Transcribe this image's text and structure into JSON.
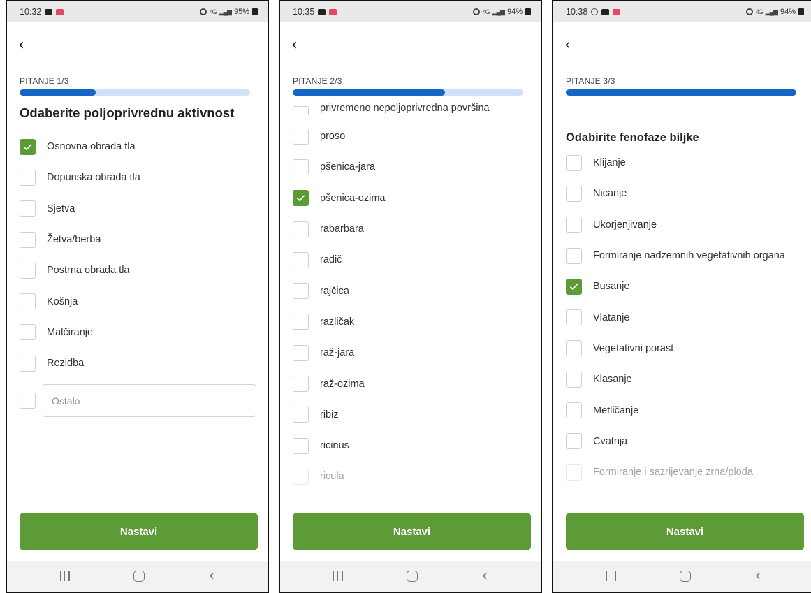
{
  "screens": [
    {
      "status": {
        "time": "10:32",
        "battery": "95%",
        "network": "4G"
      },
      "question_label": "PITANJE 1/3",
      "progress": 0.33,
      "title": "Odaberite poljoprivrednu aktivnost",
      "options": [
        {
          "label": "Osnovna obrada tla",
          "checked": true
        },
        {
          "label": "Dopunska obrada tla",
          "checked": false
        },
        {
          "label": "Sjetva",
          "checked": false
        },
        {
          "label": "Žetva/berba",
          "checked": false
        },
        {
          "label": "Postrna obrada tla",
          "checked": false
        },
        {
          "label": "Košnja",
          "checked": false
        },
        {
          "label": "Malčiranje",
          "checked": false
        },
        {
          "label": "Rezidba",
          "checked": false
        }
      ],
      "other_placeholder": "Ostalo",
      "button_label": "Nastavi"
    },
    {
      "status": {
        "time": "10:35",
        "battery": "94%",
        "network": "4G"
      },
      "question_label": "PITANJE 2/3",
      "progress": 0.66,
      "partial_top_option": "privremeno nepoljoprivredna površina",
      "options": [
        {
          "label": "proso",
          "checked": false
        },
        {
          "label": "pšenica-jara",
          "checked": false
        },
        {
          "label": "pšenica-ozima",
          "checked": true
        },
        {
          "label": "rabarbara",
          "checked": false
        },
        {
          "label": "radič",
          "checked": false
        },
        {
          "label": "rajčica",
          "checked": false
        },
        {
          "label": "različak",
          "checked": false
        },
        {
          "label": "raž-jara",
          "checked": false
        },
        {
          "label": "raž-ozima",
          "checked": false
        },
        {
          "label": "ribiz",
          "checked": false
        },
        {
          "label": "ricinus",
          "checked": false
        },
        {
          "label": "ricula",
          "checked": false
        }
      ],
      "button_label": "Nastavi"
    },
    {
      "status": {
        "time": "10:38",
        "battery": "94%",
        "network": "4G"
      },
      "question_label": "PITANJE 3/3",
      "progress": 1.0,
      "title": "Odabirite fenofaze biljke",
      "options": [
        {
          "label": "Klijanje",
          "checked": false
        },
        {
          "label": "Nicanje",
          "checked": false
        },
        {
          "label": "Ukorjenjivanje",
          "checked": false
        },
        {
          "label": "Formiranje nadzemnih vegetativnih organa",
          "checked": false
        },
        {
          "label": "Busanje",
          "checked": true
        },
        {
          "label": "Vlatanje",
          "checked": false
        },
        {
          "label": "Vegetativni porast",
          "checked": false
        },
        {
          "label": "Klasanje",
          "checked": false
        },
        {
          "label": "Metličanje",
          "checked": false
        },
        {
          "label": "Cvatnja",
          "checked": false
        },
        {
          "label": "Formiranje i sazrijevanje zrna/ploda",
          "checked": false
        }
      ],
      "button_label": "Nastavi"
    }
  ],
  "colors": {
    "accent_green": "#5c9b35",
    "progress_blue": "#1466c6",
    "progress_track": "#cfe2f8",
    "status_bar": "#e9e9e9",
    "nav_bar": "#f2f2f2"
  },
  "icons": [
    "back-arrow-icon",
    "check-icon",
    "alarm-icon",
    "signal-icon",
    "battery-icon",
    "nav-recent-icon",
    "nav-home-icon",
    "nav-back-icon"
  ]
}
